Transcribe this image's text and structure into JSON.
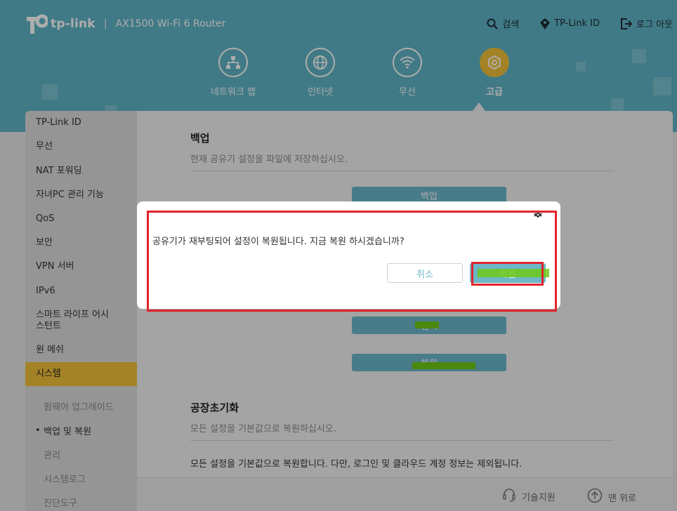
{
  "header": {
    "brand": "tp-link",
    "separator": "|",
    "model": "AX1500 Wi-Fi 6 Router",
    "actions": {
      "search": "검색",
      "tplink_id": "TP-Link ID",
      "logout": "로그 아웃"
    }
  },
  "nav": {
    "items": [
      {
        "label": "네트워크 맵",
        "icon": "network-map-icon"
      },
      {
        "label": "인터넷",
        "icon": "globe-icon"
      },
      {
        "label": "무선",
        "icon": "wifi-icon"
      },
      {
        "label": "고급",
        "icon": "gear-icon",
        "active": true
      }
    ]
  },
  "sidebar": {
    "items": [
      "TP-Link ID",
      "무선",
      "NAT 포워딩",
      "자녀PC 관리 기능",
      "QoS",
      "보안",
      "VPN 서버",
      "IPv6",
      "스마트 라이프 어시스턴트",
      "원 메쉬",
      "시스템"
    ],
    "active": "시스템",
    "subitems": [
      "펌웨어 업그레이드",
      "백업 및 복원",
      "관리",
      "시스템로그",
      "진단도구"
    ],
    "current_sub": "백업 및 복원"
  },
  "content": {
    "backup": {
      "title": "백업",
      "desc": "현재 공유기 설정을 파일에 저장하십시오.",
      "button": "백업"
    },
    "restore": {
      "browse_button": "검색",
      "restore_button": "복원"
    },
    "factory": {
      "title": "공장초기화",
      "desc": "모든 설정을 기본값으로 복원하십시오.",
      "note": "모든 설정을 기본값으로 복원합니다. 다만, 로그인 및 클라우드 계정 정보는 제외됩니다."
    }
  },
  "footer": {
    "support": "기술지원",
    "top": "맨 위로"
  },
  "dialog": {
    "message": "공유기가 재부팅되어 설정이 복원됩니다. 지금 복원 하시겠습니까?",
    "cancel": "취소",
    "confirm": "복원"
  },
  "colors": {
    "header": "#5fb4c6",
    "accent": "#f2c23a",
    "button": "#6bb7c9",
    "annotation": "#e0242c",
    "highlighter": "#6fc916"
  }
}
